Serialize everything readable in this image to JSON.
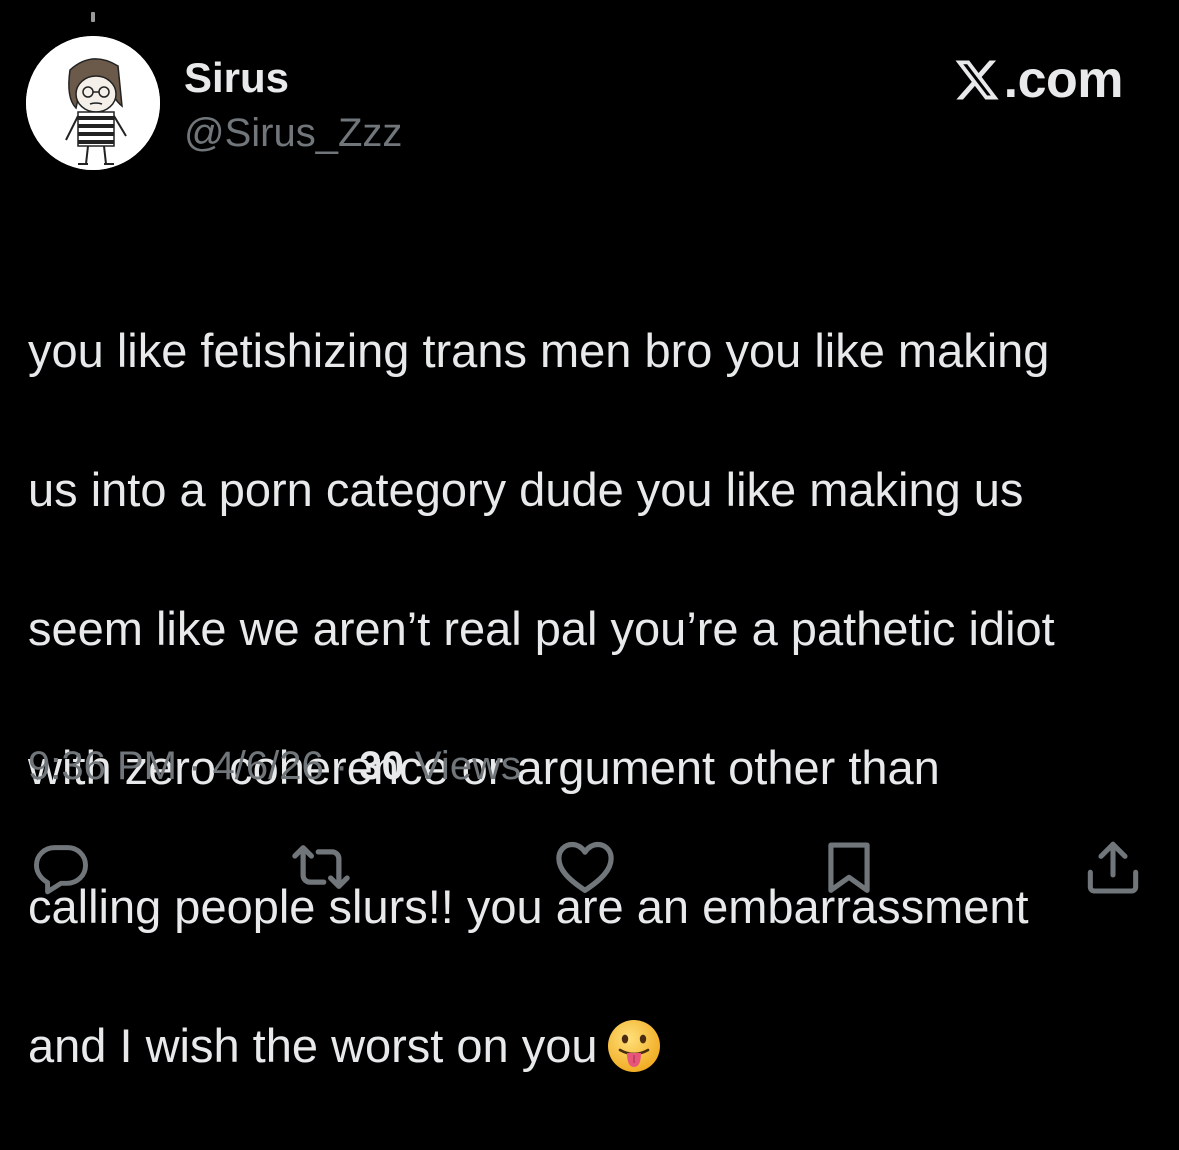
{
  "author": {
    "display_name": "Sirus",
    "handle": "@Sirus_Zzz",
    "avatar_icon": "cartoon-avatar-icon"
  },
  "brand": {
    "logo_icon": "x-logo-icon",
    "text": ".com"
  },
  "tweet": {
    "lines": [
      "you like fetishizing trans men bro you like making",
      "us into a porn category dude you like making us",
      "seem like we aren’t real pal you’re a pathetic idiot",
      "with zero coherence or argument other than",
      "calling people slurs!! you are an embarrassment",
      "and I wish the worst on you"
    ],
    "emoji": "😛",
    "emoji_icon": "face-with-tongue-emoji-icon"
  },
  "meta": {
    "time": "9:36 PM",
    "separator": "·",
    "date": "4/6/26",
    "views_count": "30",
    "views_label": "Views"
  },
  "actions": {
    "reply_icon": "reply-icon",
    "retweet_icon": "retweet-icon",
    "like_icon": "heart-icon",
    "bookmark_icon": "bookmark-icon",
    "share_icon": "share-icon"
  },
  "colors": {
    "background": "#000000",
    "primary_text": "#e7e9ea",
    "secondary_text": "#71767b",
    "emoji_yellow": "#f5c33b",
    "emoji_tongue": "#e8557a"
  }
}
